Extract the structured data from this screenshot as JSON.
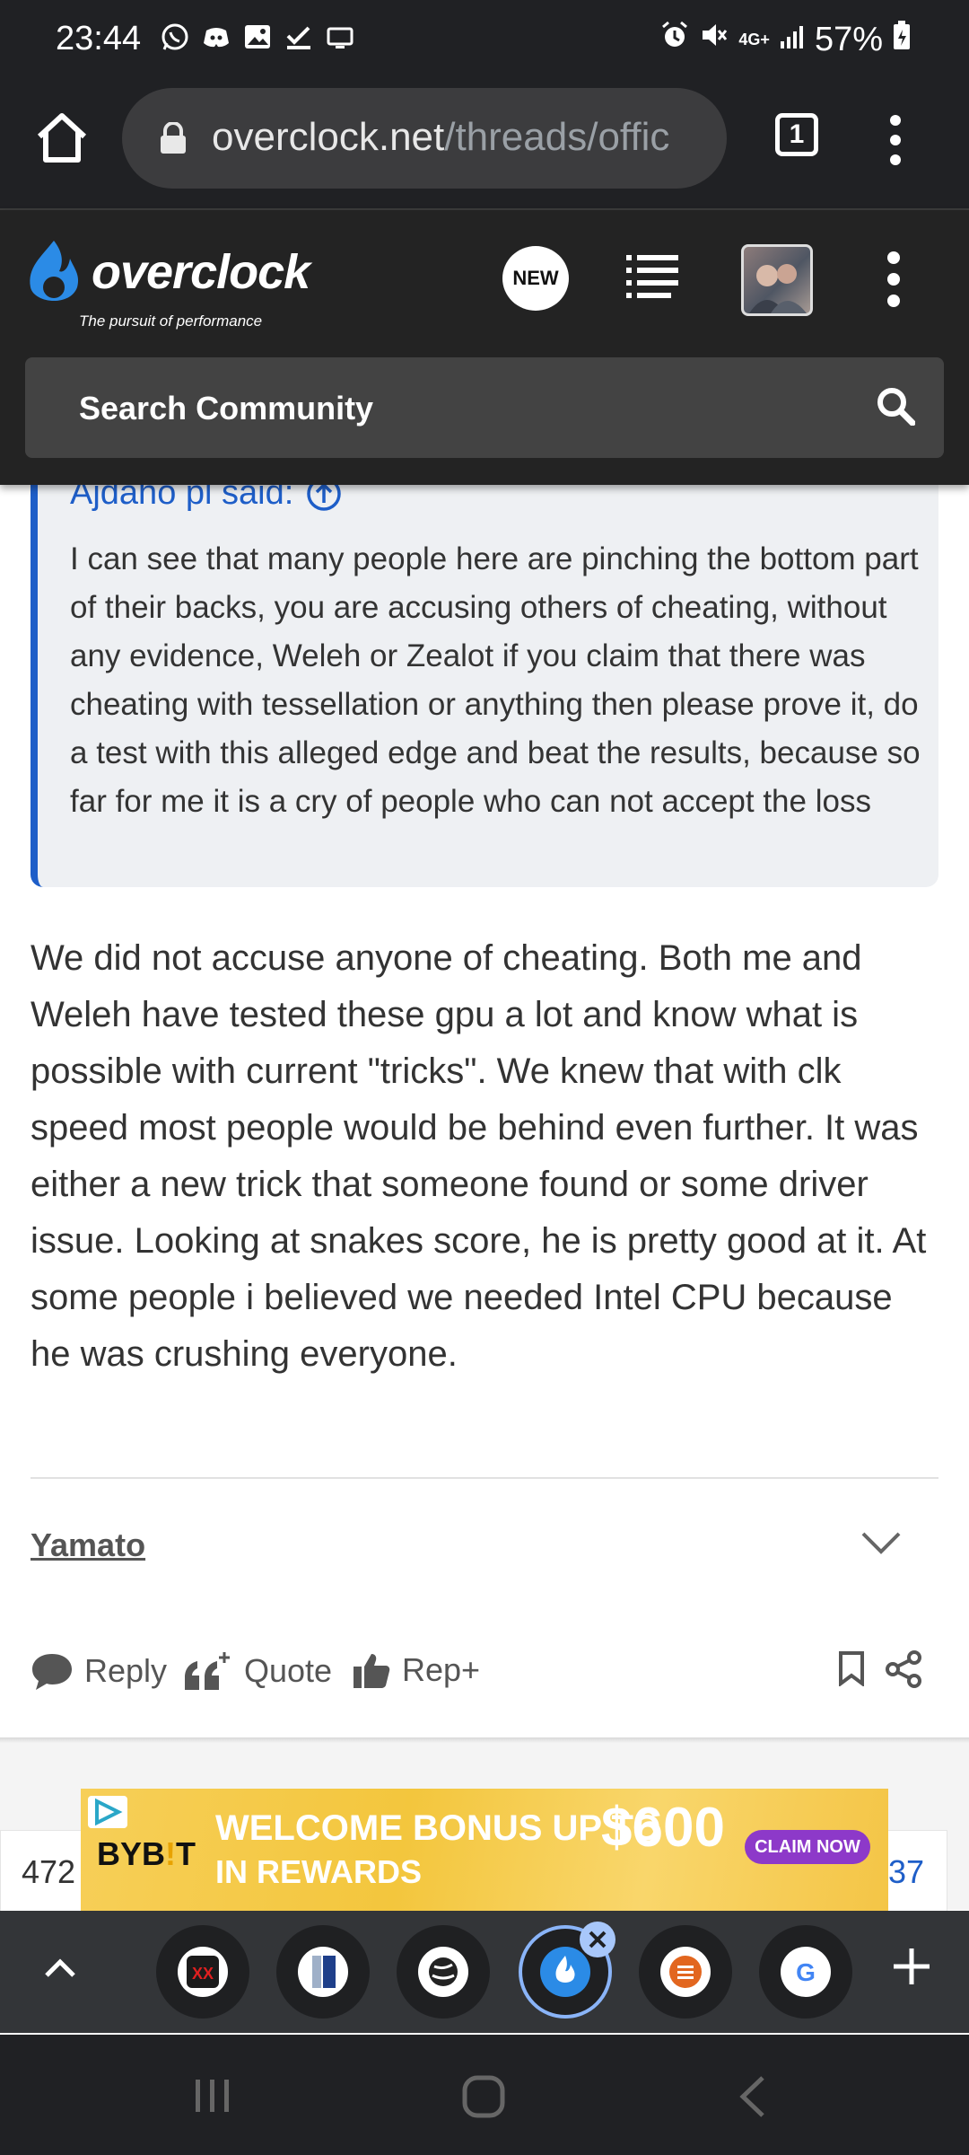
{
  "status_bar": {
    "time": "23:44",
    "notification_icons": [
      "whatsapp-icon",
      "discord-icon",
      "gallery-icon",
      "check-icon",
      "screen-icon"
    ],
    "system_icons": [
      "alarm-icon",
      "mute-icon",
      "4g-icon",
      "signal-icon"
    ],
    "network": "4G+",
    "battery": "57%"
  },
  "browser": {
    "url_domain": "overclock.net",
    "url_path": "/threads/offic",
    "tab_count": "1"
  },
  "site": {
    "logo_text": "overclock",
    "tagline": "The pursuit of performance",
    "new_badge": "NEW",
    "search_placeholder": "Search Community"
  },
  "quote": {
    "author": "Ajdaho pl said:",
    "text": "I can see that many people here are pinching the bottom part of their backs, you are accusing others of cheating, without any evidence, Weleh or Zealot if you claim that there was cheating with tessellation or anything then please prove it, do a test with this alleged edge and beat the results, because so far for me it is a cry of people who can not accept the loss"
  },
  "post": {
    "body": "We did not accuse anyone of cheating. Both me and Weleh have tested these gpu a lot and know what is possible with current \"tricks\". We knew that with clk speed most people would be behind even further. It was either a new trick that someone found or some driver issue. Looking at snakes score, he is pretty good at it. At some people i believed we needed Intel CPU because he was crushing everyone.",
    "signature_user": "Yamato",
    "actions": {
      "reply": "Reply",
      "quote": "Quote",
      "rep": "Rep+"
    }
  },
  "next_post_partial": {
    "left": "472",
    "right": "37"
  },
  "ad": {
    "brand_left": "BYB",
    "brand_mid": "!",
    "brand_right": "T",
    "headline_1": "WELCOME BONUS UP TO",
    "amount": "$600",
    "headline_2": "IN REWARDS",
    "cta": "CLAIM NOW"
  },
  "tab_strip": {
    "tabs": [
      "red-app-tab",
      "blue-page-tab",
      "globe-tab",
      "ocn-tab-active",
      "orange-tab",
      "google-tab"
    ]
  },
  "colors": {
    "accent": "#1e5ec8",
    "header_bg": "#232323",
    "chrome_bg": "#202124"
  }
}
